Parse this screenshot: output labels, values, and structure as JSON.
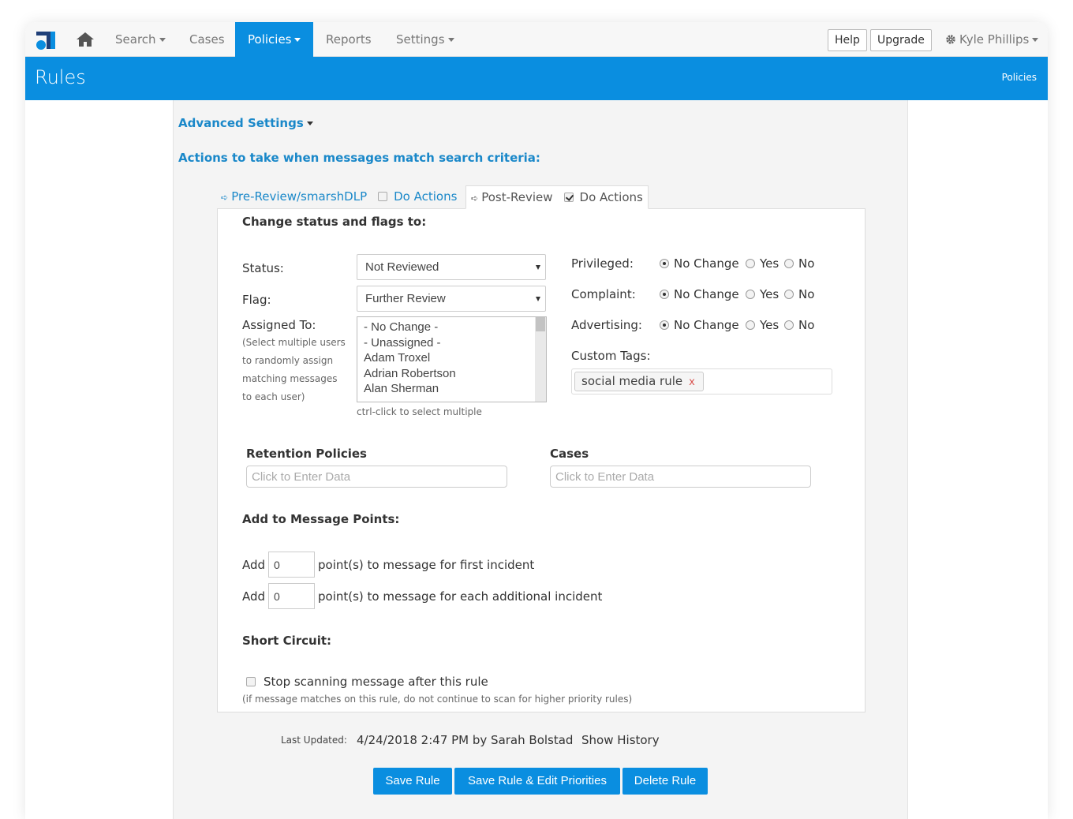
{
  "nav": {
    "items": [
      "Search",
      "Cases",
      "Policies",
      "Reports",
      "Settings"
    ],
    "help": "Help",
    "upgrade": "Upgrade",
    "user": "Kyle Phillips"
  },
  "header": {
    "title": "Rules",
    "breadcrumb": "Policies"
  },
  "advanced_settings": "Advanced Settings",
  "actions_heading": "Actions to take when messages match search criteria:",
  "tabs": {
    "pre": {
      "label": "Pre-Review/smarshDLP",
      "do_actions": "Do Actions",
      "checked": false
    },
    "post": {
      "label": "Post-Review",
      "do_actions": "Do Actions",
      "checked": true
    }
  },
  "form": {
    "change_heading": "Change status and flags to:",
    "status_label": "Status:",
    "status_value": "Not Reviewed",
    "flag_label": "Flag:",
    "flag_value": "Further Review",
    "assigned_label": "Assigned To:",
    "assigned_hint": [
      "(Select multiple users",
      "to randomly assign",
      "matching messages",
      "to each user)"
    ],
    "assigned_options": [
      "- No Change -",
      "- Unassigned -",
      "Adam Troxel",
      "Adrian Robertson",
      "Alan Sherman"
    ],
    "assigned_help": "ctrl-click to select multiple",
    "privileged_label": "Privileged:",
    "complaint_label": "Complaint:",
    "advertising_label": "Advertising:",
    "radio_options": [
      "No Change",
      "Yes",
      "No"
    ],
    "custom_tags_label": "Custom Tags:",
    "custom_tag": "social media rule",
    "tag_remove": "x",
    "retention_label": "Retention Policies",
    "cases_label": "Cases",
    "enter_placeholder": "Click to Enter Data",
    "points_heading": "Add to Message Points:",
    "add_label": "Add",
    "points_first_value": "0",
    "points_first_text": "point(s) to message for first incident",
    "points_each_value": "0",
    "points_each_text": "point(s) to message for each additional incident",
    "short_circuit_heading": "Short Circuit:",
    "stop_scanning": "Stop scanning message after this rule",
    "stop_hint": "(if message matches on this rule, do not continue to scan for higher priority rules)"
  },
  "footer": {
    "last_updated_label": "Last Updated:",
    "last_updated_value": "4/24/2018 2:47 PM by Sarah Bolstad",
    "show_history": "Show History",
    "save": "Save Rule",
    "save_edit": "Save Rule & Edit Priorities",
    "delete": "Delete Rule"
  },
  "colors": {
    "accent": "#0a8ee0",
    "link": "#1a88c9"
  }
}
